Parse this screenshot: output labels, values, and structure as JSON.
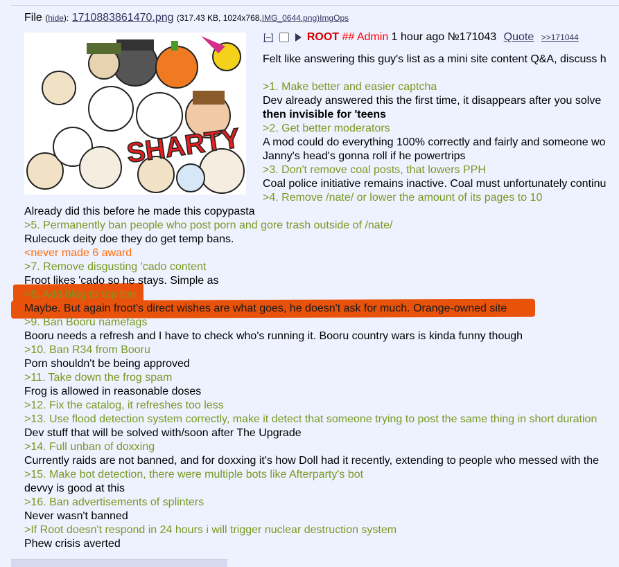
{
  "file": {
    "label": "File",
    "hide_link": "hide",
    "filename": "1710883861470.png",
    "meta": "(317.43 KB, 1024x768,",
    "orig_name": "IMG_0644.png)",
    "imgops": "ImgOps"
  },
  "thumbnail": {
    "alt": "wojak collage with SHARTY text",
    "sticker_text": "SHARTY"
  },
  "post": {
    "hide": "[–]",
    "name": "ROOT",
    "trip": "## Admin",
    "time": "1 hour ago",
    "number": "№171043",
    "quote_label": "Quote",
    "backlink": ">>171044"
  },
  "body": [
    {
      "text": "Felt like answering this guy's list as a mini site content Q&A, discuss h",
      "style": "normal"
    },
    {
      "text": "",
      "style": "blank"
    },
    {
      "text": ">1. Make better and easier captcha",
      "style": "gt"
    },
    {
      "text": "Dev already answered this the first time, it disappears after you solve",
      "style": "normal"
    },
    {
      "text": "then invisible for 'teens",
      "style": "bold"
    },
    {
      "text": ">2. Get better moderators",
      "style": "gt"
    },
    {
      "text": "A mod could do everything 100% correctly and fairly and someone wo",
      "style": "normal"
    },
    {
      "text": "Janny's head's gonna roll if he powertrips",
      "style": "normal"
    },
    {
      "text": ">3. Don't remove coal posts, that lowers PPH",
      "style": "gt"
    },
    {
      "text": "Coal police initiative remains inactive. Coal must unfortunately continu",
      "style": "normal"
    },
    {
      "text": ">4. Remove /nate/ or lower the amount of its pages to 10",
      "style": "gt"
    },
    {
      "text": "Already did this before he made this copypasta",
      "style": "normal"
    },
    {
      "text": ">5. Permanently ban people who post porn and gore trash outside of /nate/",
      "style": "gt"
    },
    {
      "text": "Rulecuck deity doe they do get temp bans.",
      "style": "normal"
    },
    {
      "text": "<never made 6 award",
      "style": "orange"
    },
    {
      "text": ">7. Remove disgusting 'cado content",
      "style": "gt"
    },
    {
      "text": "Froot likes 'cado so he stays. Simple as",
      "style": "normal"
    },
    {
      "text": ">8. Add blog to top bar",
      "style": "gt-hl"
    },
    {
      "text": "Maybe. But again froot's direct wishes are what goes, he doesn't ask for much. Orange-owned site",
      "style": "hl"
    },
    {
      "text": ">9. Ban Booru namefags",
      "style": "gt"
    },
    {
      "text": "Booru needs a refresh and I have to check who's running it. Booru country wars is kinda funny though",
      "style": "normal"
    },
    {
      "text": ">10. Ban R34 from Booru",
      "style": "gt"
    },
    {
      "text": "Porn shouldn't be being approved",
      "style": "normal"
    },
    {
      "text": ">11. Take down the frog spam",
      "style": "gt"
    },
    {
      "text": "Frog is allowed in reasonable doses",
      "style": "normal"
    },
    {
      "text": ">12. Fix the catalog, it refreshes too less",
      "style": "gt"
    },
    {
      "text": ">13. Use flood detection system correctly, make it detect that someone trying to post the same thing in short duration",
      "style": "gt"
    },
    {
      "text": "Dev stuff that will be solved with/soon after The Upgrade",
      "style": "normal"
    },
    {
      "text": ">14. Full unban of doxxing",
      "style": "gt"
    },
    {
      "text": "Currently raids are not banned, and for doxxing it's how Doll had it recently, extending to people who messed with the",
      "style": "normal"
    },
    {
      "text": ">15. Make bot detection, there were multiple bots like Afterparty's bot",
      "style": "gt"
    },
    {
      "text": "devvy is good at this",
      "style": "normal"
    },
    {
      "text": ">16. Ban advertisements of splinters",
      "style": "gt"
    },
    {
      "text": "Never wasn't banned",
      "style": "normal"
    },
    {
      "text": ">If Root doesn't respond in 24 hours i will trigger nuclear destruction system",
      "style": "gt"
    },
    {
      "text": "Phew crisis averted",
      "style": "normal"
    }
  ],
  "colors": {
    "background": "#eef2ff",
    "greentext": "#789922",
    "orangetext": "#ff6c0a",
    "name": "#d40000",
    "highlight": "#e8520b",
    "link": "#34345c"
  }
}
